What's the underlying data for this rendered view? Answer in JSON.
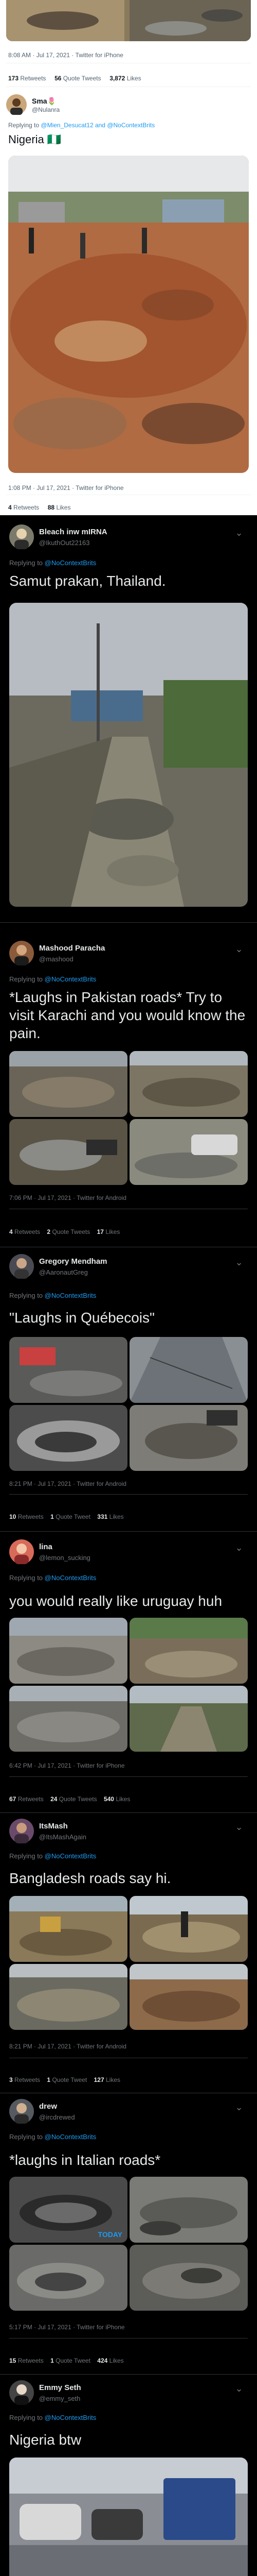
{
  "tweet0": {
    "timestamp": "8:08 AM · Jul 17, 2021 · Twitter for iPhone",
    "retweets": "173",
    "retweets_label": "Retweets",
    "quotes": "56",
    "quotes_label": "Quote Tweets",
    "likes": "3,872",
    "likes_label": "Likes"
  },
  "tweet1": {
    "name": "Sma🌷",
    "handle": "@Nulanra",
    "replying_prefix": "Replying to",
    "replying_to": "@Mien_Desucat12 and @NoContextBrits",
    "text": "Nigeria 🇳🇬",
    "timestamp": "1:08 PM · Jul 17, 2021 · Twitter for iPhone",
    "retweets": "4",
    "retweets_label": "Retweets",
    "likes": "88",
    "likes_label": "Likes"
  },
  "tweet2": {
    "name": "Bleach inw mIRNA",
    "handle": "@IkuthOut22163",
    "replying_prefix": "Replying to",
    "replying_to": "@NoContextBrits",
    "text": "Samut prakan, Thailand."
  },
  "tweet3": {
    "name": "Mashood Paracha",
    "handle": "@mashood",
    "replying_prefix": "Replying to",
    "replying_to": "@NoContextBrits",
    "text": "*Laughs in Pakistan roads* Try to visit Karachi and you would know the pain.",
    "timestamp": "7:06 PM · Jul 17, 2021 · Twitter for Android",
    "retweets": "4",
    "retweets_label": "Retweets",
    "quotes": "2",
    "quotes_label": "Quote Tweets",
    "likes": "17",
    "likes_label": "Likes"
  },
  "tweet4": {
    "name": "Gregory Mendham",
    "handle": "@AaronautGreg",
    "replying_prefix": "Replying to",
    "replying_to": "@NoContextBrits",
    "text": "\"Laughs in Québecois\"",
    "timestamp": "8:21 PM · Jul 17, 2021 · Twitter for Android",
    "retweets": "10",
    "retweets_label": "Retweets",
    "quotes": "1",
    "quotes_label": "Quote Tweet",
    "likes": "331",
    "likes_label": "Likes"
  },
  "tweet5": {
    "name": "lina",
    "handle": "@lemon_sucking",
    "replying_prefix": "Replying to",
    "replying_to": "@NoContextBrits",
    "text": "you would really like uruguay huh",
    "timestamp": "6:42 PM · Jul 17, 2021 · Twitter for iPhone",
    "retweets": "67",
    "retweets_label": "Retweets",
    "quotes": "24",
    "quotes_label": "Quote Tweets",
    "likes": "540",
    "likes_label": "Likes"
  },
  "tweet6": {
    "name": "ItsMash",
    "handle": "@ItsMashAgain",
    "replying_prefix": "Replying to",
    "replying_to": "@NoContextBrits",
    "text": "Bangladesh roads say hi.",
    "timestamp": "8:21 PM · Jul 17, 2021 · Twitter for Android",
    "retweets": "3",
    "retweets_label": "Retweets",
    "quotes": "1",
    "quotes_label": "Quote Tweet",
    "likes": "127",
    "likes_label": "Likes"
  },
  "tweet7": {
    "name": "drew",
    "handle": "@ircdrewed",
    "replying_prefix": "Replying to",
    "replying_to": "@NoContextBrits",
    "text": "*laughs in Italian roads*",
    "photo_overlay": "TODAY",
    "timestamp": "5:17 PM · Jul 17, 2021 · Twitter for iPhone",
    "retweets": "15",
    "retweets_label": "Retweets",
    "quotes": "1",
    "quotes_label": "Quote Tweet",
    "likes": "424",
    "likes_label": "Likes"
  },
  "tweet8": {
    "name": "Emmy Seth",
    "handle": "@emmy_seth",
    "replying_prefix": "Replying to",
    "replying_to": "@NoContextBrits",
    "text": "Nigeria btw"
  },
  "colors": {
    "background": "#000000",
    "card_white": "#ffffff",
    "link_blue": "#1d9bf0",
    "muted_gray": "#71767b",
    "text_light": "#e7e9ea",
    "text_dark": "#0f1419"
  },
  "icons": {
    "more": "chevron-down-icon",
    "flag": "nigeria-flag-icon"
  }
}
